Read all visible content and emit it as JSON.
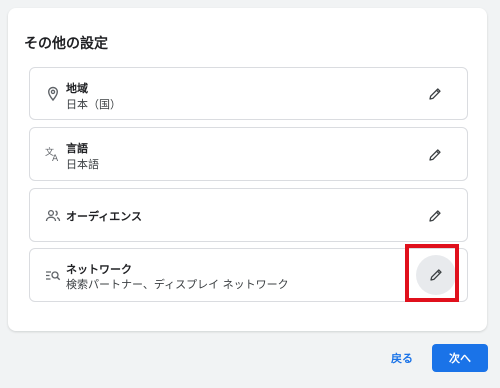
{
  "section": {
    "title": "その他の設定"
  },
  "items": [
    {
      "title": "地域",
      "subtitle": "日本（国）",
      "icon": "location-pin-icon"
    },
    {
      "title": "言語",
      "subtitle": "日本語",
      "icon": "translate-icon"
    },
    {
      "title": "オーディエンス",
      "subtitle": "",
      "icon": "people-icon"
    },
    {
      "title": "ネットワーク",
      "subtitle": "検索パートナー、ディスプレイ ネットワーク",
      "icon": "network-search-icon"
    }
  ],
  "footer": {
    "back_label": "戻る",
    "next_label": "次へ"
  },
  "colors": {
    "accent": "#1a73e8",
    "highlight": "#e0101c",
    "card_border": "#dadce0"
  }
}
